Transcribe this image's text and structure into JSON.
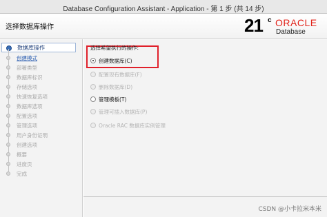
{
  "window": {
    "title": "Database Configuration Assistant - Application - 第 1 步 (共 14 步)"
  },
  "header": {
    "page_title": "选择数据库操作",
    "logo": {
      "version": "21",
      "version_sup": "c",
      "brand": "ORACLE",
      "product": "Database"
    }
  },
  "sidebar": {
    "steps": [
      {
        "label": "数据库操作",
        "state": "current"
      },
      {
        "label": "创建模式",
        "state": "link"
      },
      {
        "label": "部署类型",
        "state": "disabled"
      },
      {
        "label": "数据库标识",
        "state": "disabled"
      },
      {
        "label": "存储选项",
        "state": "disabled"
      },
      {
        "label": "快速恢复选项",
        "state": "disabled"
      },
      {
        "label": "数据库选项",
        "state": "disabled"
      },
      {
        "label": "配置选项",
        "state": "disabled"
      },
      {
        "label": "管理选项",
        "state": "disabled"
      },
      {
        "label": "用户身份证明",
        "state": "disabled"
      },
      {
        "label": "创建选项",
        "state": "disabled"
      },
      {
        "label": "概要",
        "state": "disabled"
      },
      {
        "label": "进度页",
        "state": "disabled"
      },
      {
        "label": "完成",
        "state": "disabled"
      }
    ]
  },
  "main": {
    "prompt": "选择希望执行的操作:",
    "options": [
      {
        "label": "创建数据库(C)",
        "checked": true,
        "disabled": false
      },
      {
        "label": "配置现有数据库(F)",
        "checked": false,
        "disabled": true
      },
      {
        "label": "删除数据库(D)",
        "checked": false,
        "disabled": true
      },
      {
        "label": "管理模板(T)",
        "checked": false,
        "disabled": false
      },
      {
        "label": "管理可插入数据库(P)",
        "checked": false,
        "disabled": true
      },
      {
        "label": "Oracle RAC 数据库实例管理",
        "checked": false,
        "disabled": true
      }
    ]
  },
  "watermark": "CSDN @小卡拉米本米"
}
